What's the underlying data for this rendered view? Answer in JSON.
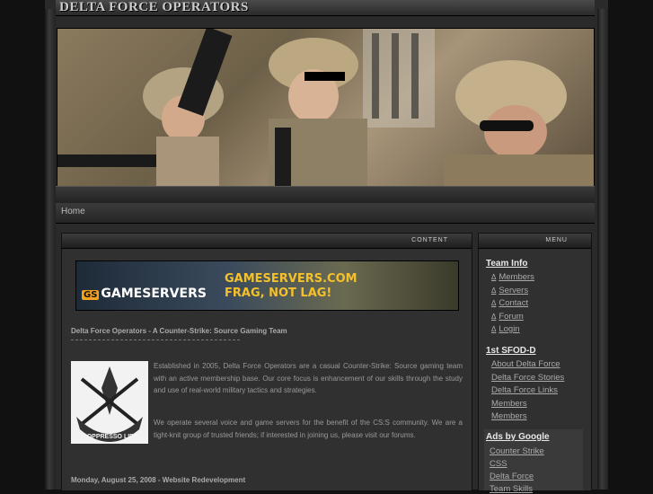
{
  "header": {
    "site_title": "DELTA FORCE OPERATORS"
  },
  "nav": {
    "home": "Home"
  },
  "content_tab": {
    "label": "CONTENT"
  },
  "menu_tab": {
    "label": "MENU"
  },
  "ad": {
    "logo": "GAMESERVERS",
    "logo_mark": "GS",
    "line1": "GAMESERVERS.COM",
    "line2": "FRAG, NOT LAG!"
  },
  "main": {
    "heading": "Delta Force Operators - A Counter-Strike: Source Gaming Team",
    "rule": "-----------------------------------------------------------------------",
    "para1": "Established in 2005, Delta Force Operators are a casual Counter-Strike: Source gaming team with an active membership base. Our core focus is enhancement of our skills through the study and use of real-world military tactics and strategies.",
    "para2": "We operate several voice and game servers for the benefit of the CS:S community. We are a tight-knit group of trusted friends; if interested in joining us, please visit our forums.",
    "emblem_motto": "DE OPPRESSO LIBER",
    "post_date": "Monday, August 25, 2008 - Website Redevelopment"
  },
  "sidebar": {
    "team_info": "Team Info",
    "team_links": [
      "Members",
      "Servers",
      "Contact",
      "Forum",
      "Login"
    ],
    "sfod": "1st SFOD-D",
    "sfod_links": [
      "About Delta Force",
      "Delta Force Stories",
      "Delta Force Links",
      "Members",
      "Members"
    ],
    "ads_title": "Ads by Google",
    "ads_links": [
      "Counter Strike",
      "CSS",
      "Delta Force",
      "Team Skills"
    ]
  },
  "colors": {
    "accent_text": "#e8e8e8",
    "ad_yellow": "#f5c12a",
    "background": "#111111"
  }
}
